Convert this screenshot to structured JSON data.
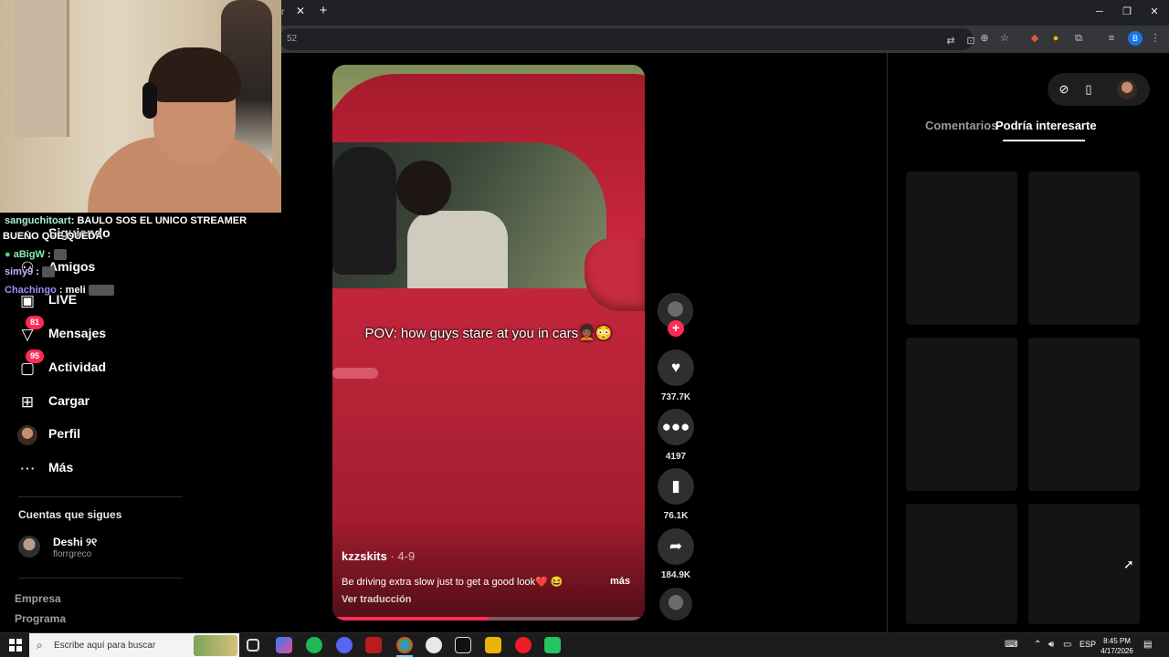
{
  "browser": {
    "tab_fragment": "r",
    "address_fragment": "52",
    "close_glyph": "✕",
    "new_tab_glyph": "+",
    "profile_letter": "B"
  },
  "chat": [
    {
      "user": "sanguchitoart",
      "text": ": BAULO SOS EL UNICO STREAMER",
      "color": "#a7f3d0"
    },
    {
      "user": "",
      "text": "BUENO QUE QUEDA",
      "color": "#ffffff"
    },
    {
      "user": "aBigW",
      "text": " :",
      "color": "#86efac"
    },
    {
      "user": "simy9",
      "text": " :",
      "color": "#c4b5fd"
    },
    {
      "user": "Chachingo",
      "text": " : meli",
      "color": "#a78bfa"
    }
  ],
  "nav": {
    "following_label": "Siguiendo",
    "friends_label": "Amigos",
    "live_label": "LIVE",
    "messages_label": "Mensajes",
    "messages_badge": "81",
    "activity_label": "Actividad",
    "activity_badge": "95",
    "upload_label": "Cargar",
    "profile_label": "Perfil",
    "more_label": "Más"
  },
  "following_section": {
    "title": "Cuentas que sigues",
    "accounts": [
      {
        "name": "Deshi ୨୧",
        "handle": "florrgreco"
      }
    ]
  },
  "footer": {
    "company": "Empresa",
    "program": "Programa"
  },
  "video": {
    "overlay_caption": "POV: how guys stare at you in cars🧑🏾‍🦱😳",
    "author": "kzzskits",
    "date": " · 4-9",
    "description": "Be driving extra slow just to get a good look❤️ 😆",
    "more_label": "más",
    "translate_label": "Ver traducción",
    "progress": 0.5
  },
  "actions": {
    "likes": "737.7K",
    "comments": "4197",
    "saves": "76.1K",
    "shares": "184.9K"
  },
  "right_panel": {
    "tab_comments": "Comentarios",
    "tab_suggested": "Podría interesarte"
  },
  "taskbar": {
    "search_placeholder": "Escribe aquí para buscar",
    "language": "ESP",
    "time": "8:45 PM",
    "date": "4/17/2026"
  },
  "colors": {
    "accent": "#fe2c55",
    "background": "#000000",
    "tile": "#141414"
  }
}
